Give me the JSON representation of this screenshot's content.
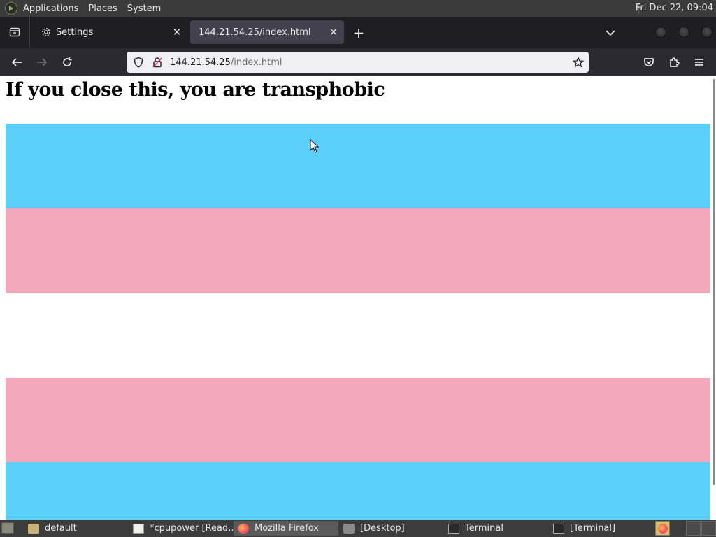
{
  "top_panel": {
    "menus": [
      "Applications",
      "Places",
      "System"
    ],
    "clock": "Fri Dec 22, 09:04"
  },
  "tabs": [
    {
      "label": "Settings",
      "icon": "gear-icon",
      "active": false
    },
    {
      "label": "144.21.54.25/index.html",
      "icon": "",
      "active": true
    }
  ],
  "url_bar": {
    "host": "144.21.54.25",
    "path": "/index.html"
  },
  "page": {
    "heading": "If you close this, you are transphobic",
    "flag_colors": {
      "blue": "#5bcefa",
      "pink": "#f2a8b8",
      "white": "#ffffff"
    }
  },
  "taskbar": {
    "items": [
      {
        "label": "default",
        "icon": "folder-icon",
        "active": false
      },
      {
        "label": "*cpupower [Read...",
        "icon": "text-editor-icon",
        "active": false
      },
      {
        "label": "Mozilla Firefox",
        "icon": "firefox-icon",
        "active": true
      },
      {
        "label": "[Desktop]",
        "icon": "folder-icon",
        "active": false
      },
      {
        "label": "Terminal",
        "icon": "terminal-icon",
        "active": false
      },
      {
        "label": "[Terminal]",
        "icon": "terminal-icon",
        "active": false
      }
    ]
  }
}
